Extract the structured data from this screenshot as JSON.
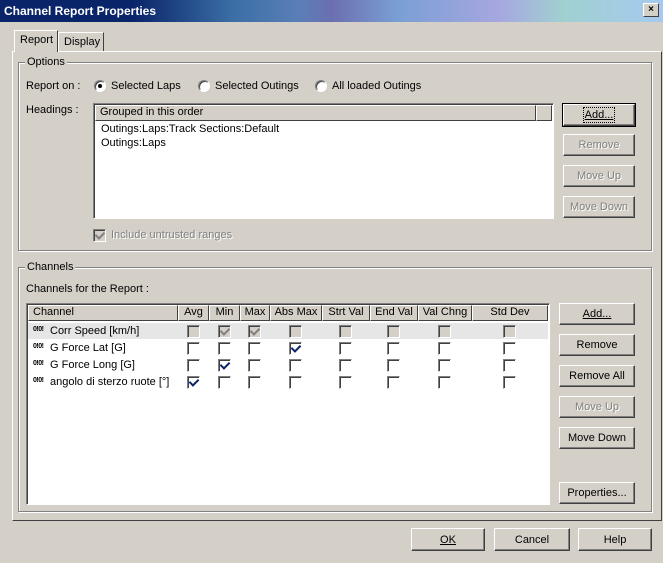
{
  "window": {
    "title": "Channel Report Properties",
    "close": "×"
  },
  "tabs": [
    {
      "label": "Report"
    },
    {
      "label": "Display"
    }
  ],
  "options": {
    "group_label": "Options",
    "report_on_label": "Report on :",
    "radios": [
      {
        "label": "Selected Laps",
        "selected": true
      },
      {
        "label": "Selected Outings",
        "selected": false
      },
      {
        "label": "All loaded Outings",
        "selected": false
      }
    ],
    "headings_label": "Headings :",
    "headings_column": "Grouped in this order",
    "headings_items": [
      "Outings:Laps:Track Sections:Default",
      "Outings:Laps"
    ],
    "include_untrusted": "Include untrusted ranges",
    "buttons": {
      "add": "Add...",
      "remove": "Remove",
      "move_up": "Move Up",
      "move_down": "Move Down"
    }
  },
  "channels": {
    "group_label": "Channels",
    "for_report_label": "Channels for the Report :",
    "columns": [
      "Channel",
      "Avg",
      "Min",
      "Max",
      "Abs Max",
      "Strt Val",
      "End Val",
      "Val Chng",
      "Std Dev"
    ],
    "channel_icon": "0!0!",
    "rows": [
      {
        "name": "Corr Speed [km/h]",
        "checks": [
          false,
          true,
          true,
          false,
          false,
          false,
          false,
          false
        ],
        "disabled": true
      },
      {
        "name": "G Force Lat [G]",
        "checks": [
          false,
          false,
          false,
          true,
          false,
          false,
          false,
          false
        ],
        "disabled": false
      },
      {
        "name": "G Force Long [G]",
        "checks": [
          false,
          true,
          false,
          false,
          false,
          false,
          false,
          false
        ],
        "disabled": false
      },
      {
        "name": "angolo di sterzo ruote [°]",
        "checks": [
          true,
          false,
          false,
          false,
          false,
          false,
          false,
          false
        ],
        "disabled": false
      }
    ],
    "buttons": {
      "add": "Add...",
      "remove": "Remove",
      "remove_all": "Remove All",
      "move_up": "Move Up",
      "move_down": "Move Down",
      "properties": "Properties..."
    }
  },
  "footer": {
    "ok": "OK",
    "cancel": "Cancel",
    "help": "Help"
  }
}
